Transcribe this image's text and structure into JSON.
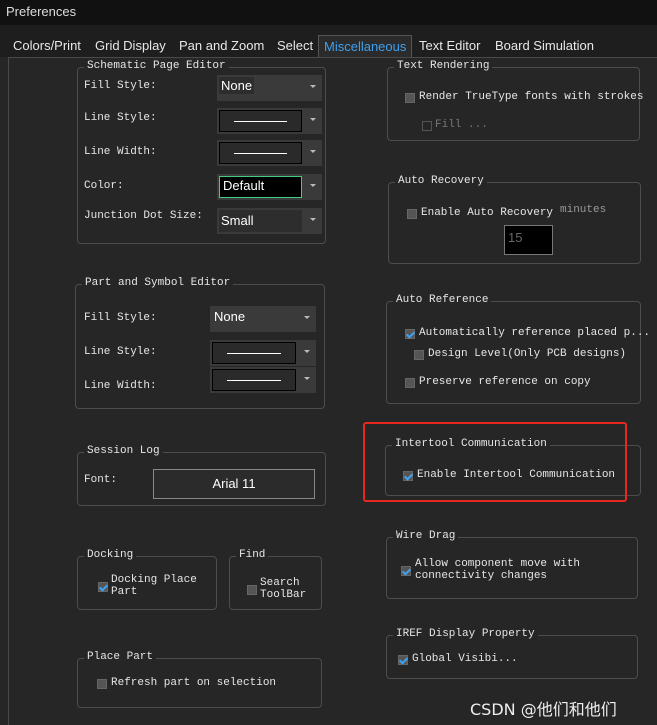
{
  "window": {
    "title": "Preferences"
  },
  "tabs": [
    "Colors/Print",
    "Grid Display",
    "Pan and Zoom",
    "Select",
    "Miscellaneous",
    "Text Editor",
    "Board Simulation"
  ],
  "active_tab": "Miscellaneous",
  "schematic": {
    "title": "Schematic Page Editor",
    "fill_style_label": "Fill Style:",
    "fill_style": "None",
    "line_style_label": "Line Style:",
    "line_width_label": "Line Width:",
    "color_label": "Color:",
    "color": "Default",
    "junction_label": "Junction Dot Size:",
    "junction": "Small"
  },
  "part": {
    "title": "Part and Symbol Editor",
    "fill_style_label": "Fill Style:",
    "fill_style": "None",
    "line_style_label": "Line Style:",
    "line_width_label": "Line Width:"
  },
  "session": {
    "title": "Session Log",
    "font_label": "Font:",
    "font": "Arial 11"
  },
  "docking": {
    "title": "Docking",
    "label": "Docking Place Part",
    "checked": true
  },
  "find": {
    "title": "Find",
    "label": "Search ToolBar",
    "checked": false
  },
  "place": {
    "title": "Place Part",
    "label": "Refresh part on selection",
    "checked": false
  },
  "text_rendering": {
    "title": "Text Rendering",
    "render_label": "Render TrueType fonts with strokes",
    "fill_label": "Fill ..."
  },
  "auto_recovery": {
    "title": "Auto Recovery",
    "enable_label": "Enable Auto Recovery",
    "minutes_label": "minutes",
    "minutes": "15"
  },
  "auto_reference": {
    "title": "Auto Reference",
    "auto_label": "Automatically reference placed p...",
    "design_label": "Design Level(Only PCB designs)",
    "preserve_label": "Preserve reference on copy"
  },
  "intertool": {
    "title": "Intertool Communication",
    "enable_label": "Enable Intertool Communication",
    "checked": true
  },
  "wire_drag": {
    "title": "Wire Drag",
    "label": "Allow component move with connectivity changes",
    "checked": true
  },
  "iref": {
    "title": "IREF Display Property",
    "label": "Global Visibi...",
    "checked": true
  },
  "watermark": "CSDN @他们和他们",
  "colors": {
    "highlight": "#e8281e",
    "accent": "#3ea0ef"
  }
}
